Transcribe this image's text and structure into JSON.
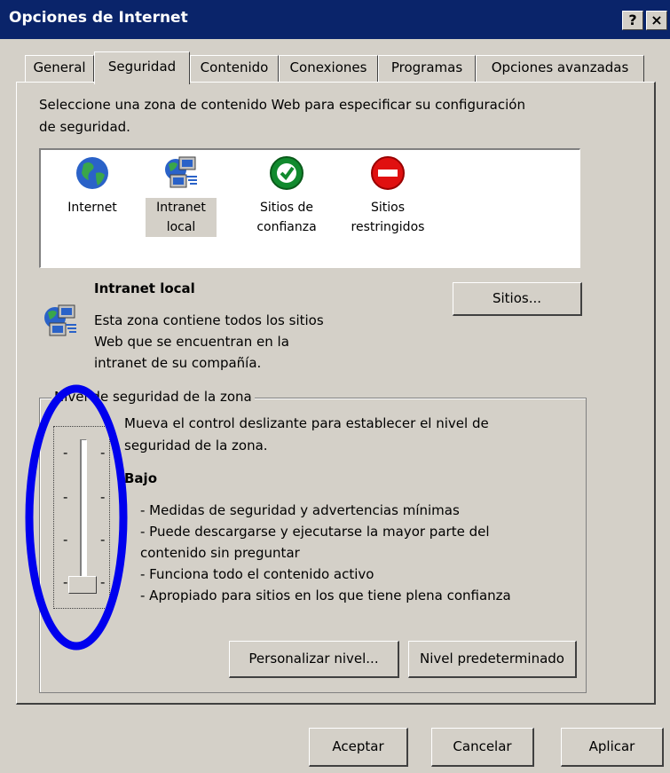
{
  "window": {
    "title": "Opciones de Internet",
    "help_glyph": "?",
    "close_glyph": "×"
  },
  "tabs": [
    {
      "label": "General"
    },
    {
      "label": "Seguridad"
    },
    {
      "label": "Contenido"
    },
    {
      "label": "Conexiones"
    },
    {
      "label": "Programas"
    },
    {
      "label": "Opciones avanzadas"
    }
  ],
  "instructions": [
    "Seleccione una zona de contenido Web para especificar su configuración",
    "de seguridad."
  ],
  "zones": [
    {
      "line1": "Internet",
      "line2": "",
      "icon": "globe-icon"
    },
    {
      "line1": "Intranet",
      "line2": "local",
      "icon": "network-computers-icon"
    },
    {
      "line1": "Sitios de",
      "line2": "confianza",
      "icon": "green-check-icon"
    },
    {
      "line1": "Sitios",
      "line2": "restringidos",
      "icon": "red-forbidden-icon"
    }
  ],
  "selected_zone": {
    "title": "Intranet local",
    "description": [
      "Esta zona contiene todos los sitios",
      "Web que se encuentran en la",
      "intranet de su compañía."
    ]
  },
  "sites_button": "Sitios...",
  "security_level": {
    "group_label": "Nivel de seguridad de la zona",
    "help": [
      "Mueva el control deslizante para establecer el nivel de",
      "seguridad de la zona."
    ],
    "level_name": "Bajo",
    "bullets": [
      "- Medidas de seguridad y advertencias mínimas",
      "- Puede descargarse y ejecutarse la mayor parte del",
      "contenido sin preguntar",
      "- Funciona todo el contenido activo",
      "- Apropiado para sitios en los que tiene plena confianza"
    ],
    "slider_level": 0
  },
  "custom_level_button": "Personalizar nivel...",
  "default_level_button": "Nivel predeterminado",
  "footer": {
    "ok": "Aceptar",
    "cancel": "Cancelar",
    "apply": "Aplicar"
  },
  "colors": {
    "title_bar": "#0a246a",
    "face": "#d4d0c8",
    "annotation": "#0000ee"
  }
}
